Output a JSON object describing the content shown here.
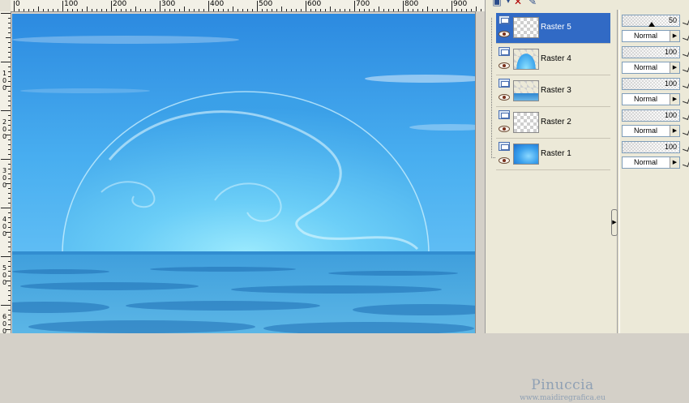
{
  "ruler_top": {
    "labels": [
      "0",
      "100",
      "200",
      "300",
      "400",
      "500",
      "600",
      "700",
      "800",
      "900"
    ]
  },
  "ruler_left": {
    "labels": [
      [
        "1",
        "0",
        "0"
      ],
      [
        "2",
        "0",
        "0"
      ],
      [
        "3",
        "0",
        "0"
      ],
      [
        "4",
        "0",
        "0"
      ],
      [
        "5",
        "0",
        "0"
      ],
      [
        "6",
        "0",
        "0"
      ]
    ]
  },
  "colors": {
    "selection": "#316ac5",
    "sky_top": "#2f8fe2",
    "sea": "#3a9fe0",
    "bubble_glow": "#8fe8ff"
  },
  "layers_toolbar": {
    "icons": [
      "new-layer-icon",
      "dropdown-arrow-icon",
      "delete-layer-icon",
      "properties-icon"
    ]
  },
  "layers": [
    {
      "name": "Raster 5",
      "selected": true,
      "thumb": "transparent",
      "opacity": "50",
      "blend_mode": "Normal"
    },
    {
      "name": "Raster 4",
      "selected": false,
      "thumb": "bubble",
      "opacity": "100",
      "blend_mode": "Normal"
    },
    {
      "name": "Raster 3",
      "selected": false,
      "thumb": "sea",
      "opacity": "100",
      "blend_mode": "Normal"
    },
    {
      "name": "Raster 2",
      "selected": false,
      "thumb": "transparent",
      "opacity": "100",
      "blend_mode": "Normal"
    },
    {
      "name": "Raster 1",
      "selected": false,
      "thumb": "sky",
      "opacity": "100",
      "blend_mode": "Normal"
    }
  ],
  "watermark": {
    "name": "Pinuccia",
    "url": "www.maidiregrafica.eu"
  }
}
